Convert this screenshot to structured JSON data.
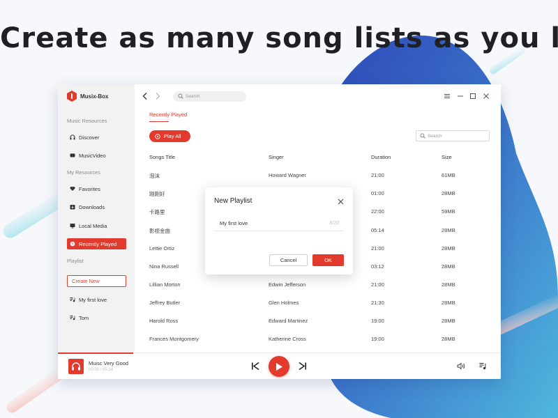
{
  "headline": "Create as many song lists as you like!",
  "app": {
    "name": "Musix-Box",
    "accent_color": "#e23b2e"
  },
  "sidebar": {
    "music_resources_label": "Music Resources",
    "discover": "Discover",
    "music_video": "MusicVideo",
    "my_resources_label": "My Resources",
    "favorites": "Favorites",
    "downloads": "Downloads",
    "local_media": "Local Media",
    "recently_played": "Recently Played",
    "playlist_label": "Playlist",
    "create_new": "Create New",
    "playlists": [
      "My first love",
      "Tom"
    ]
  },
  "topbar": {
    "search_placeholder": "Search"
  },
  "main": {
    "tab": "Recently Played",
    "play_all": "Play All",
    "search_placeholder": "Search",
    "columns": [
      "Songs Title",
      "Singer",
      "Duration",
      "Size"
    ],
    "rows": [
      {
        "title": "泡沫",
        "singer": "Howard Wagner",
        "duration": "21:00",
        "size": "61MB"
      },
      {
        "title": "刚刚好",
        "singer": "",
        "duration": "01:00",
        "size": "28MB"
      },
      {
        "title": "卡路里",
        "singer": "",
        "duration": "22:00",
        "size": "59MB"
      },
      {
        "title": "影视金曲",
        "singer": "",
        "duration": "05:14",
        "size": "28MB"
      },
      {
        "title": "Lettie Ortiz",
        "singer": "",
        "duration": "21:00",
        "size": "28MB"
      },
      {
        "title": "Nina Russell",
        "singer": "",
        "duration": "03:12",
        "size": "28MB"
      },
      {
        "title": "Lillian Morton",
        "singer": "Edwin Jefferson",
        "duration": "21:00",
        "size": "28MB"
      },
      {
        "title": "Jeffrey Butler",
        "singer": "Glen Holmes",
        "duration": "21:30",
        "size": "28MB"
      },
      {
        "title": "Harold Ross",
        "singer": "Edward Martinez",
        "duration": "19:00",
        "size": "28MB"
      },
      {
        "title": "Frances Montgomery",
        "singer": "Katherine Cross",
        "duration": "19:00",
        "size": "28MB"
      }
    ]
  },
  "player": {
    "track_title": "Muisc Very Good",
    "track_time": "00:00 / 05:14",
    "progress": 0.17
  },
  "dialog": {
    "title": "New Playlist",
    "input_value": "My first love",
    "char_count": "8/20",
    "cancel": "Cancel",
    "ok": "OK"
  }
}
